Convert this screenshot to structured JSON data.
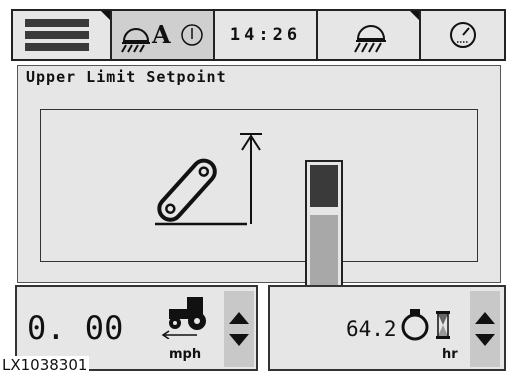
{
  "toolbar": {
    "clock": "14:26",
    "auto_label": "A"
  },
  "panel": {
    "title": "Upper Limit Setpoint",
    "setpoint_level_fraction": 0.6
  },
  "speed_box": {
    "value": "0. 00",
    "unit": "mph"
  },
  "hours_box": {
    "value": "64.2",
    "unit": "hr"
  },
  "caption": "LX1038301"
}
